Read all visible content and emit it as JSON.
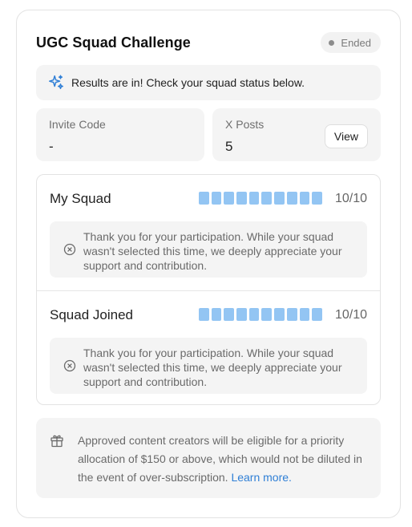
{
  "header": {
    "title": "UGC Squad Challenge",
    "status": "Ended"
  },
  "banner": {
    "icon": "sparkle-icon",
    "text": "Results are in! Check your squad status below."
  },
  "invite": {
    "label": "Invite Code",
    "value": "-"
  },
  "posts": {
    "label": "X Posts",
    "value": "5",
    "view_label": "View"
  },
  "squads": [
    {
      "name": "My Squad",
      "progress_filled": 10,
      "progress_total": 10,
      "count": "10/10",
      "icon": "x-circle-icon",
      "note": "Thank you for your participation. While your squad wasn't selected this time, we deeply appreciate your support and contribution."
    },
    {
      "name": "Squad Joined",
      "progress_filled": 10,
      "progress_total": 10,
      "count": "10/10",
      "icon": "x-circle-icon",
      "note": "Thank you for your participation. While your squad wasn't selected this time, we deeply appreciate your support and contribution."
    }
  ],
  "reward": {
    "icon": "gift-icon",
    "text": "Approved content creators will be eligible for a priority allocation of $150 or above, which would not be diluted in the event of over-subscription.",
    "link_text": "Learn more."
  },
  "colors": {
    "progress": "#93c5f3",
    "link": "#2f7fd6",
    "sparkle": "#2f7fd6"
  }
}
